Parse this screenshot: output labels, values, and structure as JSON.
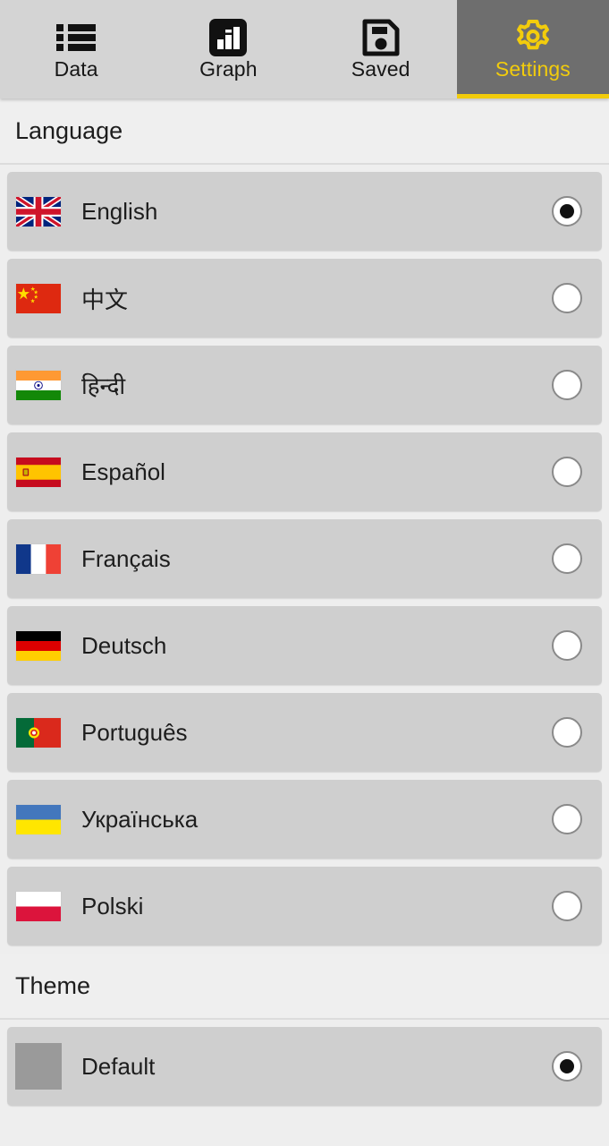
{
  "tabs": [
    {
      "label": "Data",
      "icon": "list-icon",
      "active": false
    },
    {
      "label": "Graph",
      "icon": "bar-chart-icon",
      "active": false
    },
    {
      "label": "Saved",
      "icon": "floppy-disk-icon",
      "active": false
    },
    {
      "label": "Settings",
      "icon": "gear-icon",
      "active": true
    }
  ],
  "sections": {
    "language": {
      "title": "Language",
      "items": [
        {
          "label": "English",
          "flag": "flag-gb",
          "selected": true
        },
        {
          "label": "中文",
          "flag": "flag-cn",
          "selected": false
        },
        {
          "label": "हिन्दी",
          "flag": "flag-in",
          "selected": false
        },
        {
          "label": "Español",
          "flag": "flag-es",
          "selected": false
        },
        {
          "label": "Français",
          "flag": "flag-fr",
          "selected": false
        },
        {
          "label": "Deutsch",
          "flag": "flag-de",
          "selected": false
        },
        {
          "label": "Português",
          "flag": "flag-pt",
          "selected": false
        },
        {
          "label": "Українська",
          "flag": "flag-ua",
          "selected": false
        },
        {
          "label": "Polski",
          "flag": "flag-pl",
          "selected": false
        }
      ]
    },
    "theme": {
      "title": "Theme",
      "items": [
        {
          "label": "Default",
          "swatch": "#9a9a9a",
          "selected": true
        }
      ]
    }
  },
  "colors": {
    "accent": "#f2cc0c",
    "tabbar_bg": "#d4d4d4",
    "tab_active_bg": "#6e6e6e",
    "page_bg": "#eeeeee",
    "row_bg": "#cfcfcf",
    "header_bg": "#efefef",
    "text": "#1d1d1d"
  }
}
